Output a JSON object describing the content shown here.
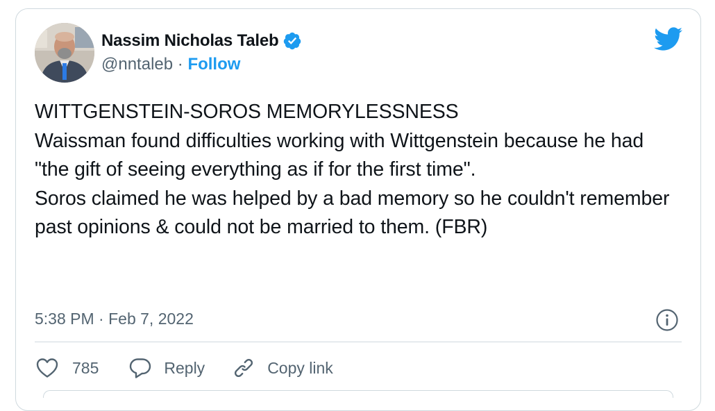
{
  "author": {
    "display_name": "Nassim Nicholas Taleb",
    "handle": "@nntaleb",
    "separator": " · ",
    "follow_label": "Follow",
    "verified": true
  },
  "tweet": {
    "text": "WITTGENSTEIN-SOROS MEMORYLESSNESS\nWaissman found difficulties working with Wittgenstein because he had \"the gift of seeing everything as if for the first time\".\nSoros claimed he was helped by a bad memory so he couldn't remember past opinions & could not be married to them. (FBR)",
    "time": "5:38 PM",
    "date_separator": " · ",
    "date": "Feb 7, 2022"
  },
  "actions": {
    "like_count": "785",
    "reply_label": "Reply",
    "copy_link_label": "Copy link"
  },
  "icons": {
    "twitter_logo": "twitter-bird-icon",
    "verified_badge": "verified-badge-icon",
    "info": "info-icon",
    "like": "heart-icon",
    "reply": "reply-bubble-icon",
    "copy_link": "link-icon"
  },
  "colors": {
    "twitter_blue": "#1d9bf0",
    "text_primary": "#0f1419",
    "text_secondary": "#536471",
    "border": "#cfd9de"
  }
}
